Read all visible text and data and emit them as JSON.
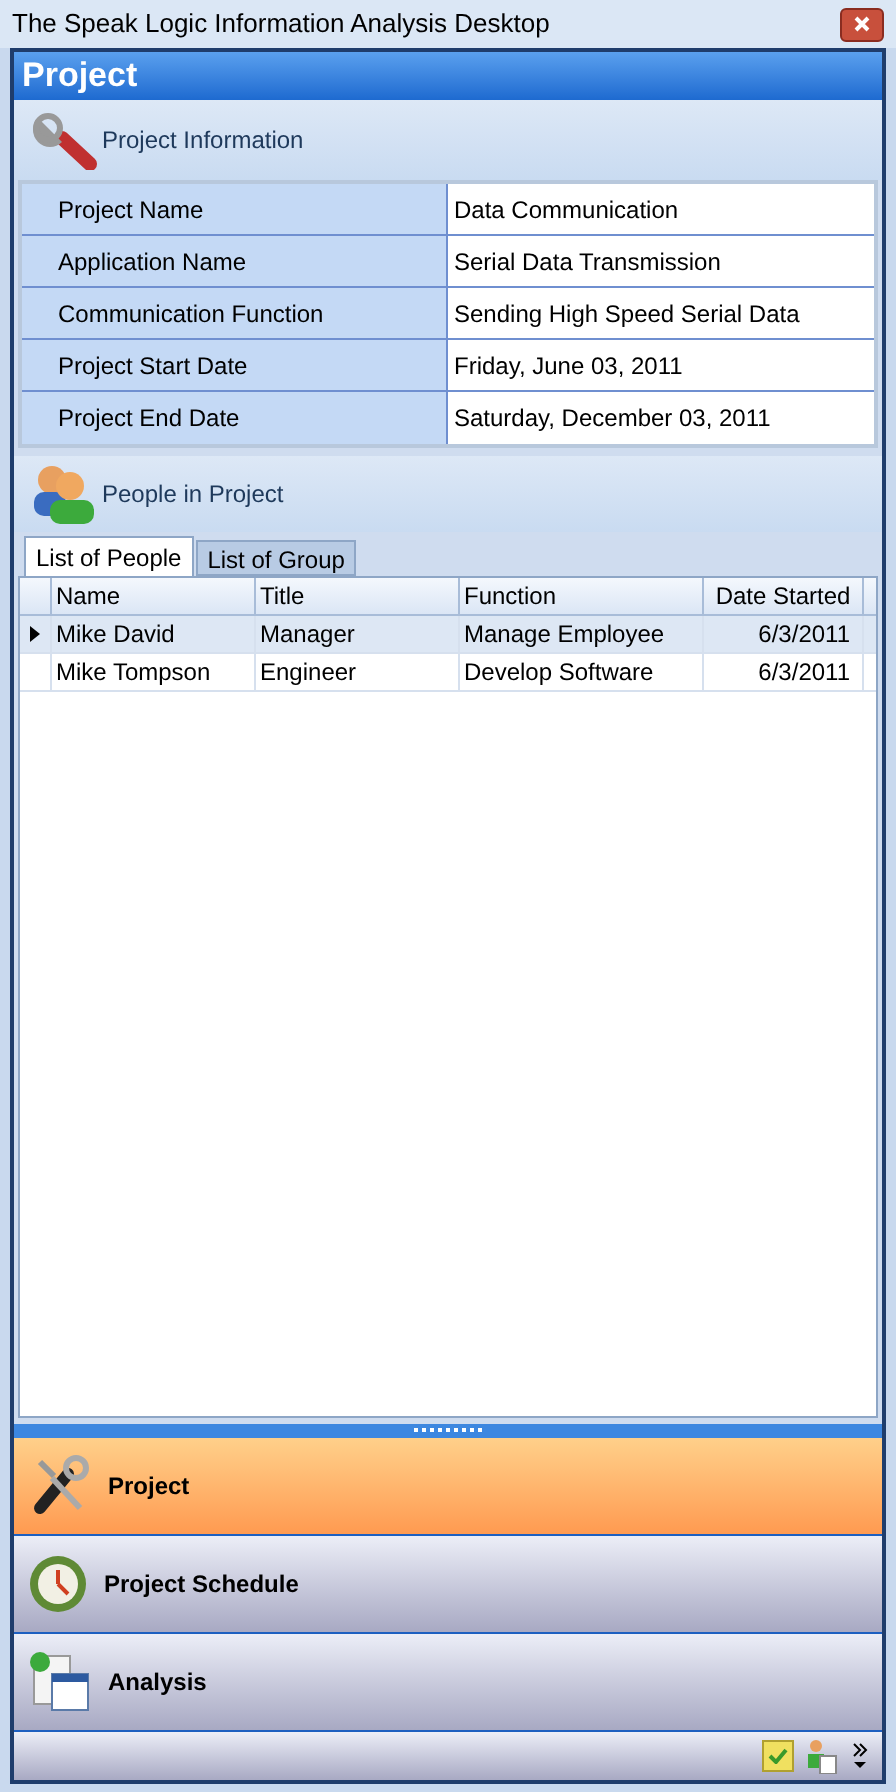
{
  "window": {
    "title": "The Speak Logic Information Analysis Desktop"
  },
  "panel": {
    "title": "Project"
  },
  "project_information": {
    "title": "Project Information",
    "fields": [
      {
        "label": "Project Name",
        "value": "Data Communication"
      },
      {
        "label": "Application Name",
        "value": "Serial Data Transmission"
      },
      {
        "label": "Communication Function",
        "value": "Sending High Speed Serial Data"
      },
      {
        "label": "Project Start Date",
        "value": "Friday, June 03, 2011"
      },
      {
        "label": "Project End Date",
        "value": "Saturday, December 03, 2011"
      }
    ]
  },
  "people_in_project": {
    "title": "People in Project",
    "tabs": [
      {
        "label": "List of People",
        "selected": true
      },
      {
        "label": "List of Group",
        "selected": false
      }
    ],
    "table": {
      "columns": [
        "Name",
        "Title",
        "Function",
        "Date Started"
      ],
      "rows": [
        {
          "cells": [
            "Mike David",
            "Manager",
            "Manage Employee",
            "6/3/2011"
          ],
          "selected": true
        },
        {
          "cells": [
            "Mike Tompson",
            "Engineer",
            "Develop Software",
            "6/3/2011"
          ],
          "selected": false
        }
      ]
    }
  },
  "navigation": [
    {
      "label": "Project",
      "kind": "tools",
      "selected": true
    },
    {
      "label": "Project Schedule",
      "kind": "clock",
      "selected": false
    },
    {
      "label": "Analysis",
      "kind": "report",
      "selected": false
    }
  ]
}
